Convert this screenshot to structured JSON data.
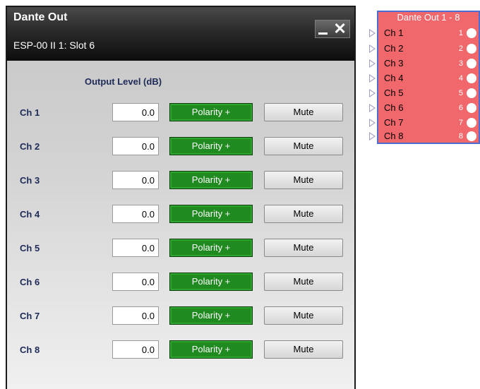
{
  "window": {
    "title": "Dante Out",
    "subtitle": "ESP-00 II 1: Slot 6",
    "column_header": "Output Level (dB)"
  },
  "channels": [
    {
      "label": "Ch 1",
      "level": "0.0",
      "polarity": "Polarity +",
      "mute": "Mute"
    },
    {
      "label": "Ch 2",
      "level": "0.0",
      "polarity": "Polarity +",
      "mute": "Mute"
    },
    {
      "label": "Ch 3",
      "level": "0.0",
      "polarity": "Polarity +",
      "mute": "Mute"
    },
    {
      "label": "Ch 4",
      "level": "0.0",
      "polarity": "Polarity +",
      "mute": "Mute"
    },
    {
      "label": "Ch 5",
      "level": "0.0",
      "polarity": "Polarity +",
      "mute": "Mute"
    },
    {
      "label": "Ch 6",
      "level": "0.0",
      "polarity": "Polarity +",
      "mute": "Mute"
    },
    {
      "label": "Ch 7",
      "level": "0.0",
      "polarity": "Polarity +",
      "mute": "Mute"
    },
    {
      "label": "Ch 8",
      "level": "0.0",
      "polarity": "Polarity +",
      "mute": "Mute"
    }
  ],
  "block": {
    "title": "Dante Out 1 - 8",
    "pins": [
      {
        "label": "Ch 1",
        "num": "1"
      },
      {
        "label": "Ch 2",
        "num": "2"
      },
      {
        "label": "Ch 3",
        "num": "3"
      },
      {
        "label": "Ch 4",
        "num": "4"
      },
      {
        "label": "Ch 5",
        "num": "5"
      },
      {
        "label": "Ch 6",
        "num": "6"
      },
      {
        "label": "Ch 7",
        "num": "7"
      },
      {
        "label": "Ch 8",
        "num": "8"
      }
    ]
  },
  "colors": {
    "polarity_green": "#1f8a1f",
    "block_red": "#f0686b",
    "block_border": "#4a6fd0",
    "label_navy": "#1e2a57"
  }
}
